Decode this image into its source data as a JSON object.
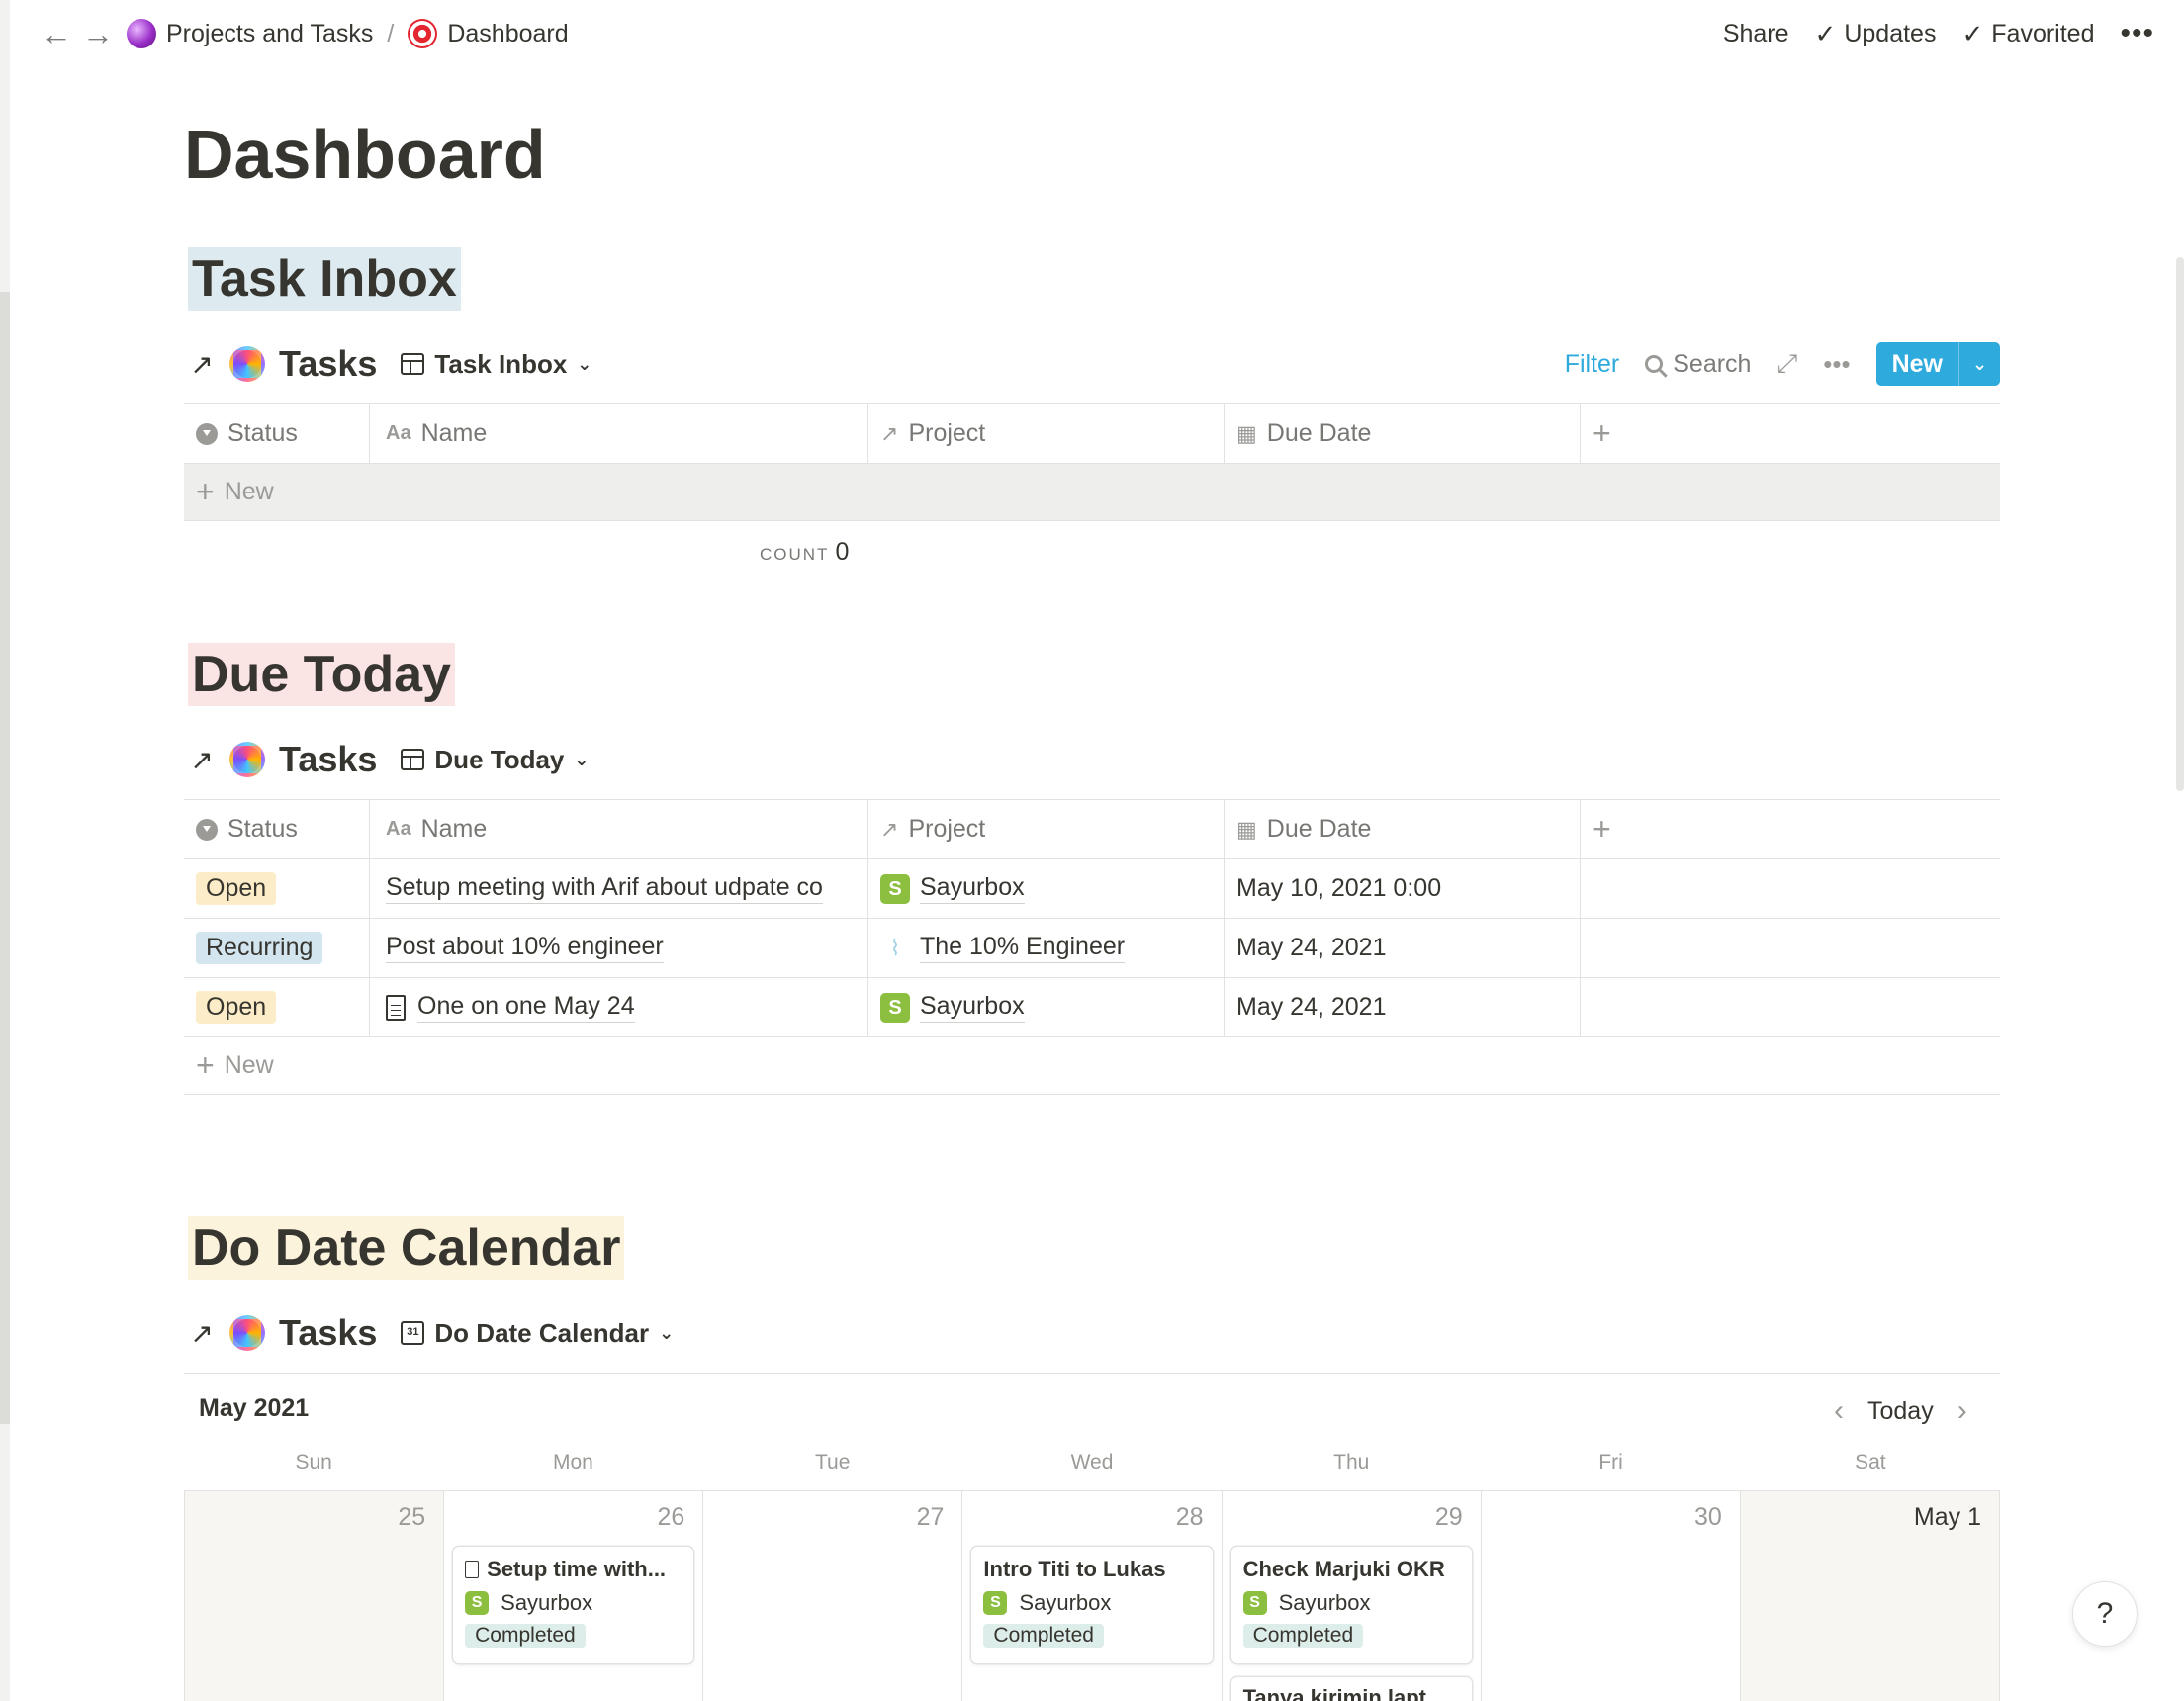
{
  "topbar": {
    "back": "←",
    "forward": "→",
    "crumbs": [
      "Projects and Tasks",
      "Dashboard"
    ],
    "separator": "/",
    "share": "Share",
    "updates": "Updates",
    "favorited": "Favorited",
    "more": "•••"
  },
  "page": {
    "title": "Dashboard"
  },
  "columns": {
    "status": "Status",
    "name": "Name",
    "project": "Project",
    "due": "Due Date"
  },
  "inbox": {
    "heading": "Task Inbox",
    "db_title": "Tasks",
    "view": "Task Inbox",
    "filter": "Filter",
    "search": "Search",
    "new_button": "New",
    "new_row": "New",
    "count_label": "COUNT",
    "count_value": "0"
  },
  "due_today": {
    "heading": "Due Today",
    "db_title": "Tasks",
    "view": "Due Today",
    "new_row": "New",
    "rows": [
      {
        "status": "Open",
        "name": "Setup meeting with Arif about udpate co",
        "project": "Sayurbox",
        "due": "May 10, 2021 0:00"
      },
      {
        "status": "Recurring",
        "name": "Post about 10% engineer",
        "project": "The 10% Engineer",
        "due": "May 24, 2021"
      },
      {
        "status": "Open",
        "name": "One on one May 24",
        "project": "Sayurbox",
        "due": "May 24, 2021"
      }
    ]
  },
  "calendar": {
    "heading": "Do Date Calendar",
    "db_title": "Tasks",
    "view": "Do Date Calendar",
    "month": "May 2021",
    "today": "Today",
    "weekdays": [
      "Sun",
      "Mon",
      "Tue",
      "Wed",
      "Thu",
      "Fri",
      "Sat"
    ],
    "days": [
      "25",
      "26",
      "27",
      "28",
      "29",
      "30",
      "May 1"
    ],
    "cards": [
      {
        "title": "Setup time with...",
        "project": "Sayurbox",
        "status": "Completed"
      },
      {
        "title": "Intro Titi to Lukas",
        "project": "Sayurbox",
        "status": "Completed"
      },
      {
        "title": "Check Marjuki OKR",
        "project": "Sayurbox",
        "status": "Completed"
      }
    ],
    "extra_card": "Tanya kirimin lapt"
  },
  "help": "?",
  "colors": {
    "accent": "#2eaadc",
    "open_tag": "#fdecc8",
    "recurring_tag": "#d3e5ef",
    "completed_tag": "#ddedea"
  }
}
